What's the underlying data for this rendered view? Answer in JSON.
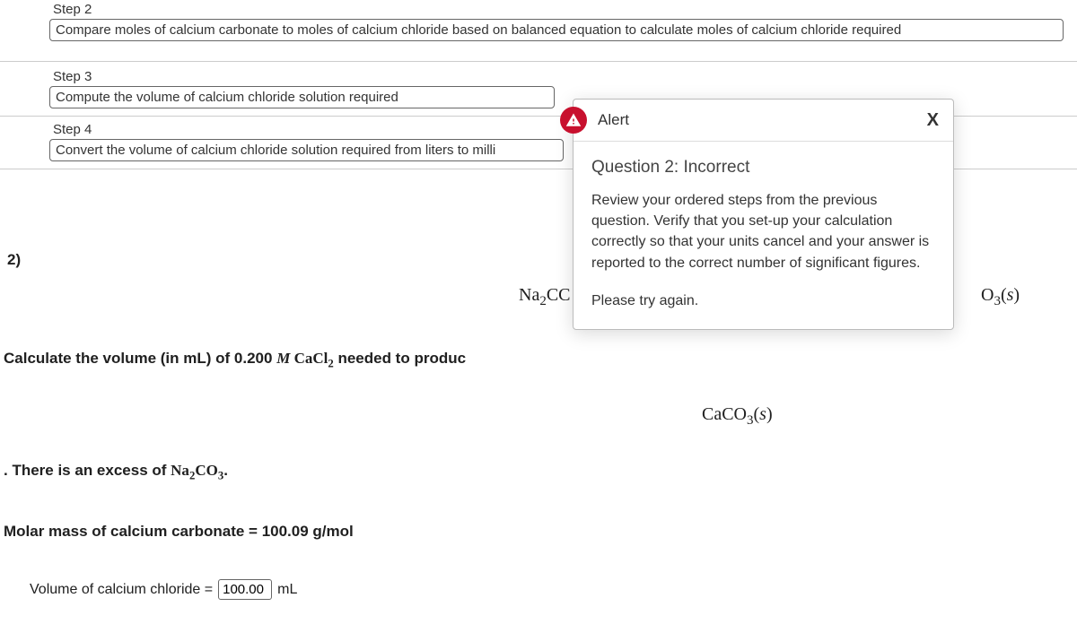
{
  "steps": [
    {
      "label": "Step 2",
      "text": "Compare moles of calcium carbonate to moles of calcium chloride based on balanced equation to calculate moles of calcium chloride required"
    },
    {
      "label": "Step 3",
      "text": "Compute the volume of calcium chloride solution required"
    },
    {
      "label": "Step 4",
      "text": "Convert the volume of calcium chloride solution required from liters to milli"
    }
  ],
  "question_number": "2)",
  "equation": {
    "na2co_fragment_html": "Na<sub>2</sub>C<span style='letter-spacing:-2px'>C</span>",
    "o3s_fragment_html": "O<sub>3</sub>(<span class='ital'>s</span>)"
  },
  "calc_line_prefix": "Calculate the volume (in mL) of 0.200 ",
  "calc_line_formula_html": "<span class='ital'>M</span> CaCl<sub>2</sub>",
  "calc_line_suffix": " needed to produc",
  "caco3_html": "CaCO<sub>3</sub>(<span class='ital'>s</span>)",
  "excess_prefix": ". There is an excess of ",
  "excess_formula_html": "Na<sub>2</sub>CO<sub>3</sub>",
  "excess_suffix": ".",
  "molar_mass_line": "Molar mass of calcium carbonate = 100.09 g/mol",
  "answer": {
    "label": "Volume of calcium chloride =",
    "value": "100.00",
    "unit": "mL"
  },
  "alert": {
    "title": "Alert",
    "close": "X",
    "heading": "Question 2: Incorrect",
    "message": "Review your ordered steps from the previous question. Verify that you set-up your calculation correctly so that your units cancel and your answer is reported to the correct number of significant figures.",
    "try_again": "Please try again."
  }
}
